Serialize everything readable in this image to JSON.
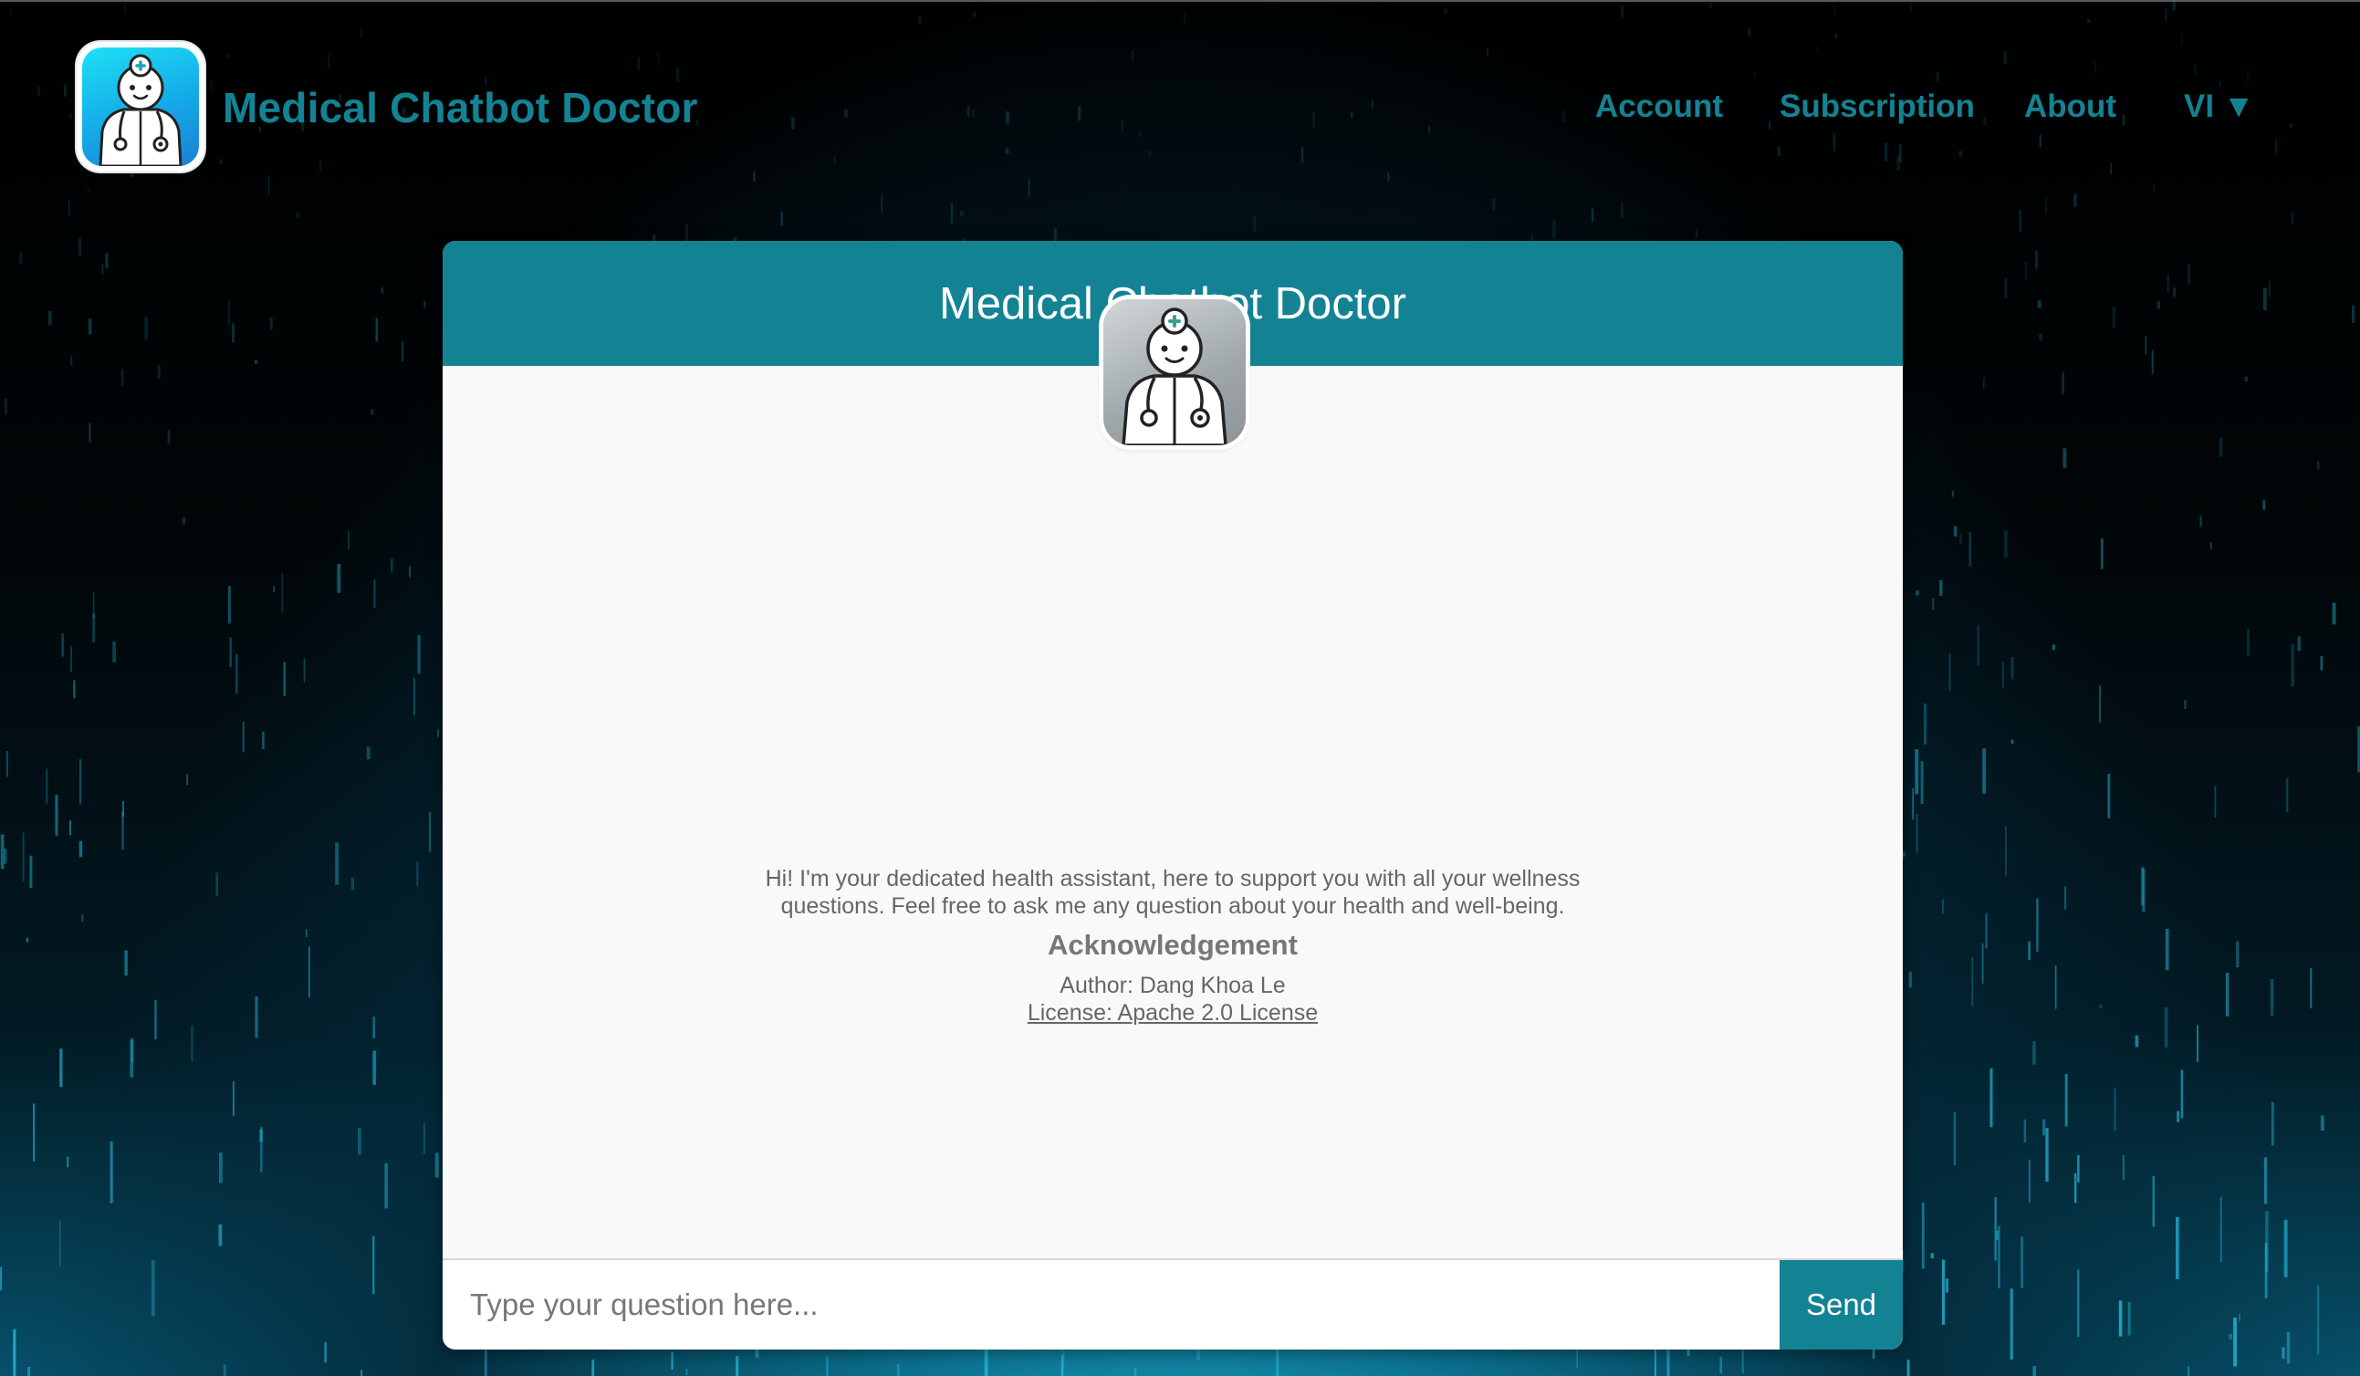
{
  "header": {
    "brand": "Medical Chatbot Doctor",
    "logo_icon": "doctor-robot-icon",
    "nav": {
      "account": "Account",
      "subscription": "Subscription",
      "about": "About",
      "language": "VI ▼"
    }
  },
  "chat": {
    "title": "Medical Chatbot Doctor",
    "avatar_icon": "doctor-avatar-icon",
    "intro": "Hi! I'm your dedicated health assistant, here to support you with all your wellness questions. Feel free to ask me any question about your health and well-being.",
    "ack_title": "Acknowledgement",
    "author": "Author: Dang Khoa Le",
    "license": "License: Apache 2.0 License",
    "input_placeholder": "Type your question here...",
    "send_label": "Send"
  },
  "colors": {
    "accent": "#138394",
    "card_background": "#f9f9f9",
    "page_background": "#000000"
  }
}
